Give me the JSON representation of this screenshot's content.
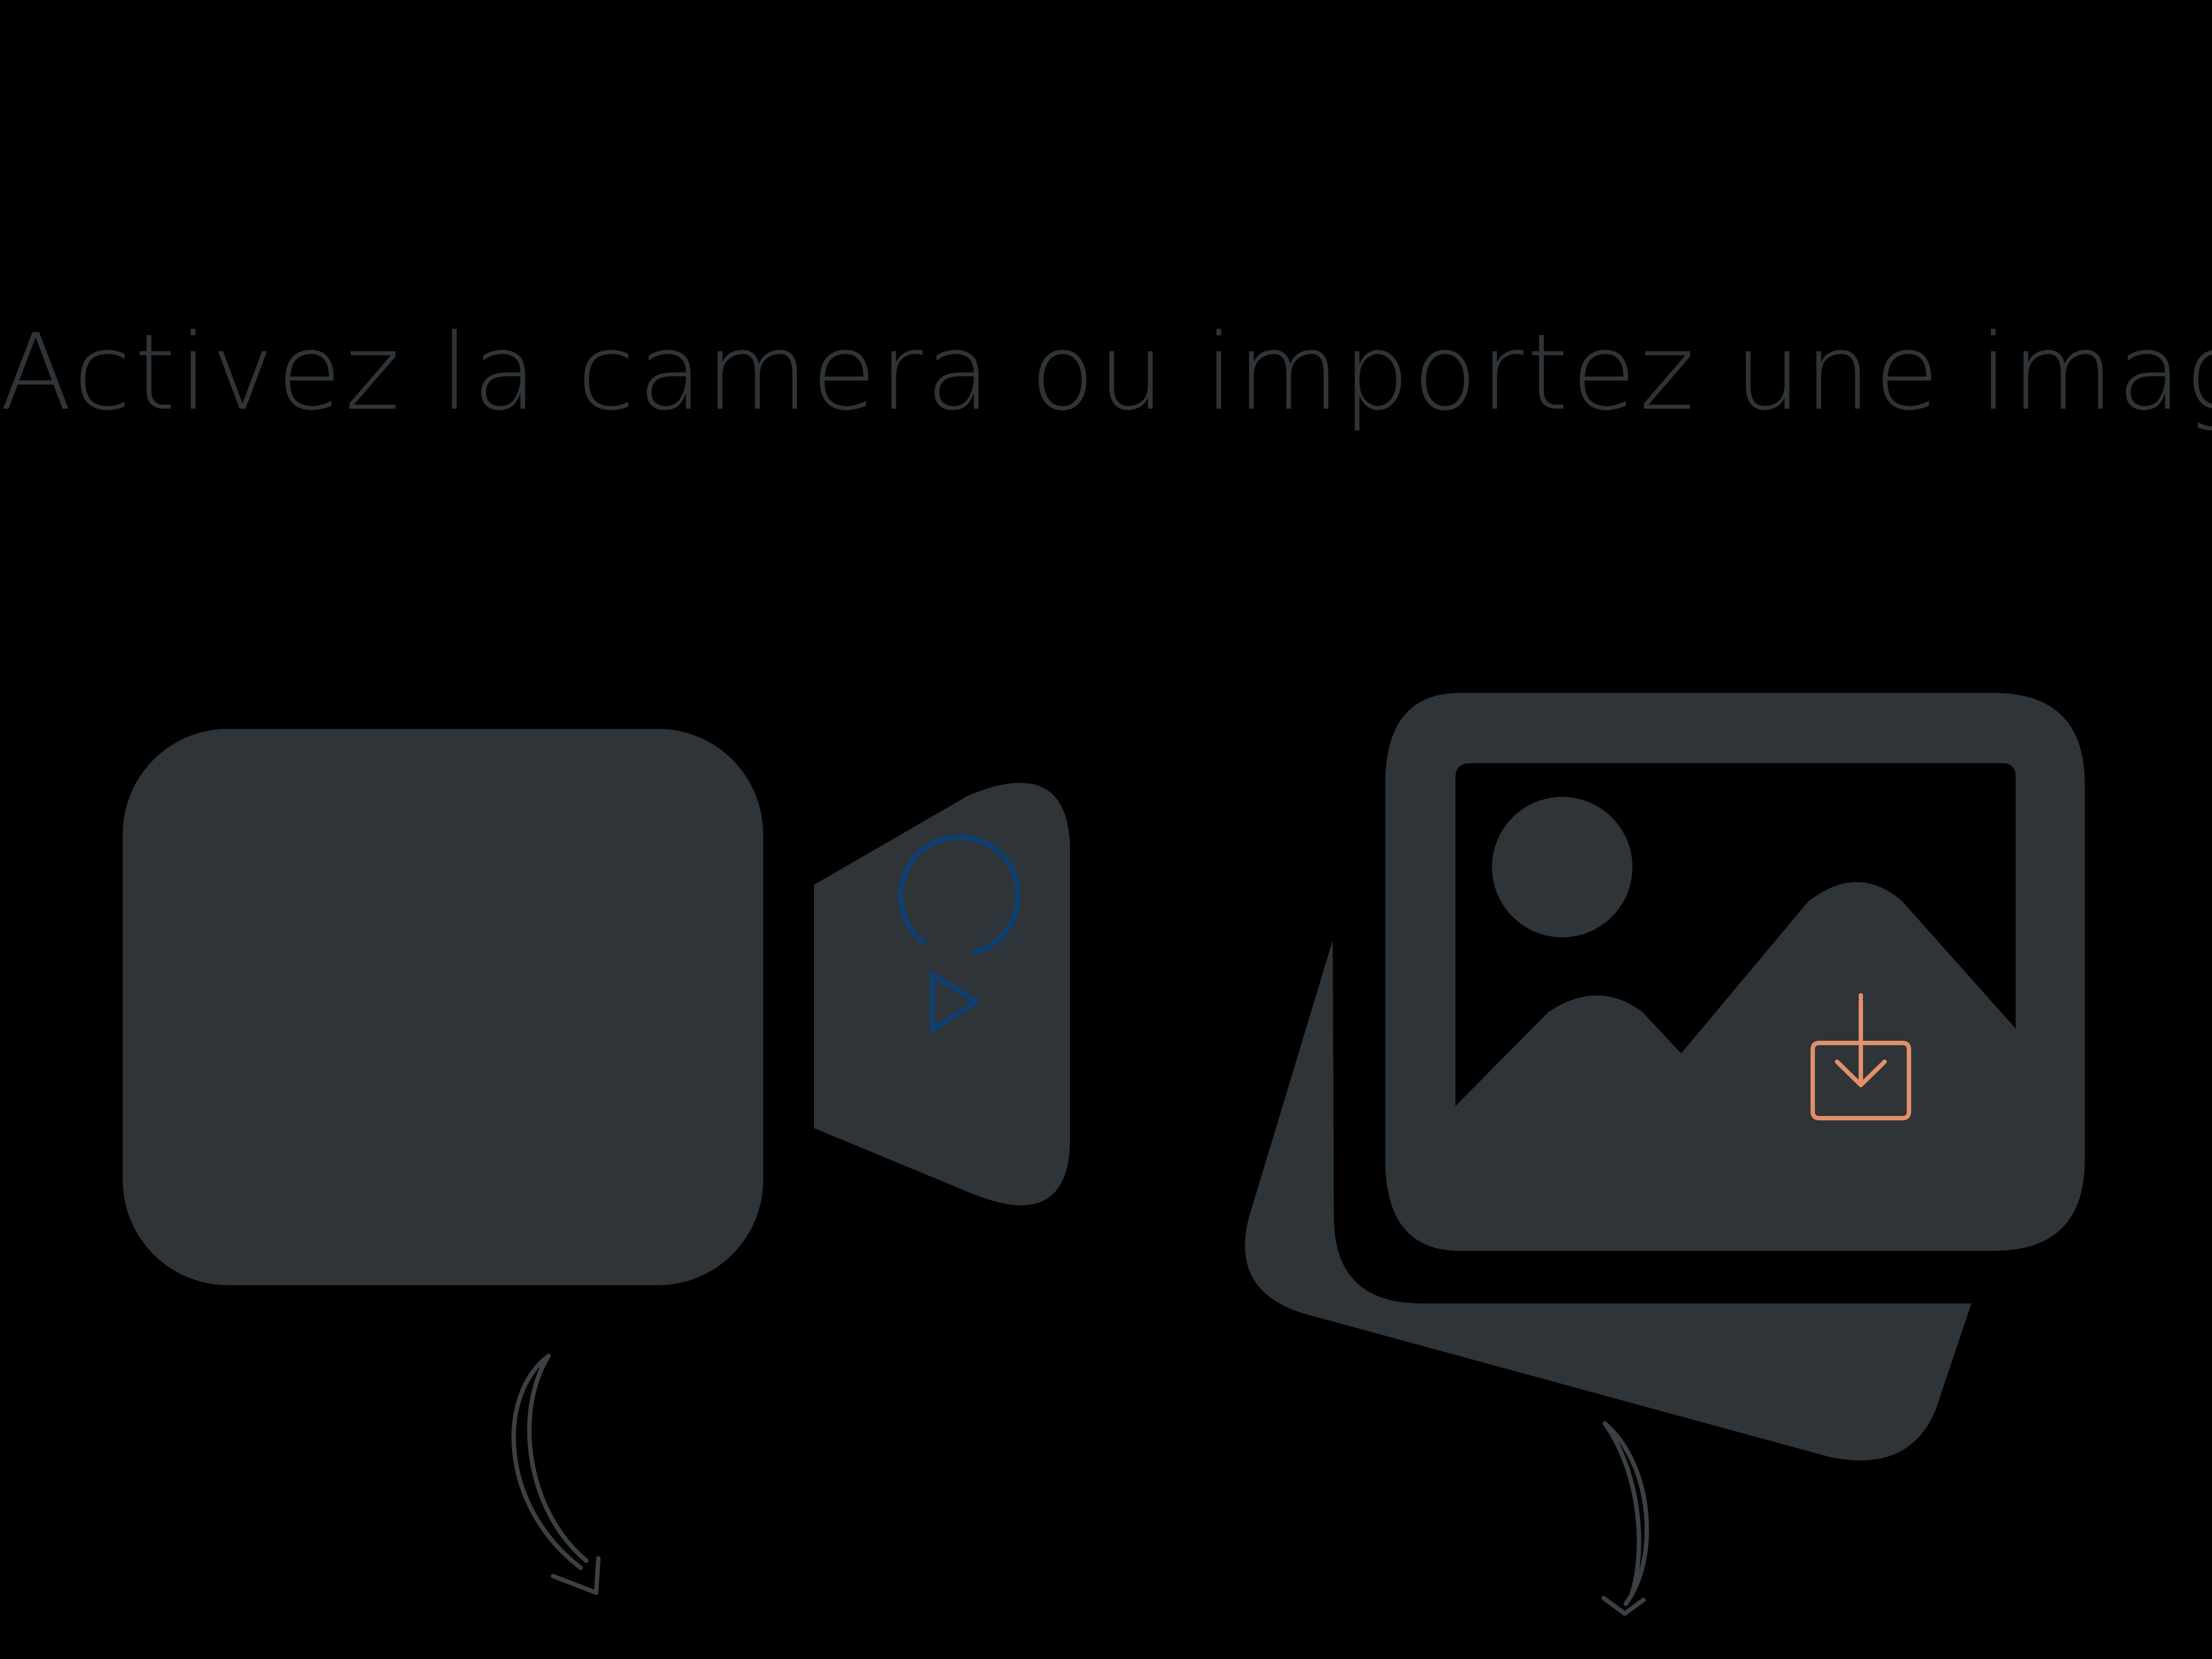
{
  "heading": "Activez la camera ou importez une image",
  "colors": {
    "background": "#000000",
    "icon_fill": "#2e3437",
    "play_accent": "#0d3f74",
    "import_accent": "#e38f6a",
    "arrow_stroke": "#3a4043"
  },
  "camera_option": {
    "icon": "video-camera-icon",
    "action_icon": "play-circle-icon",
    "pointer_icon": "curved-arrow-icon"
  },
  "import_option": {
    "icon": "image-stack-icon",
    "action_icon": "download-tray-icon",
    "pointer_icon": "curved-arrow-icon"
  }
}
